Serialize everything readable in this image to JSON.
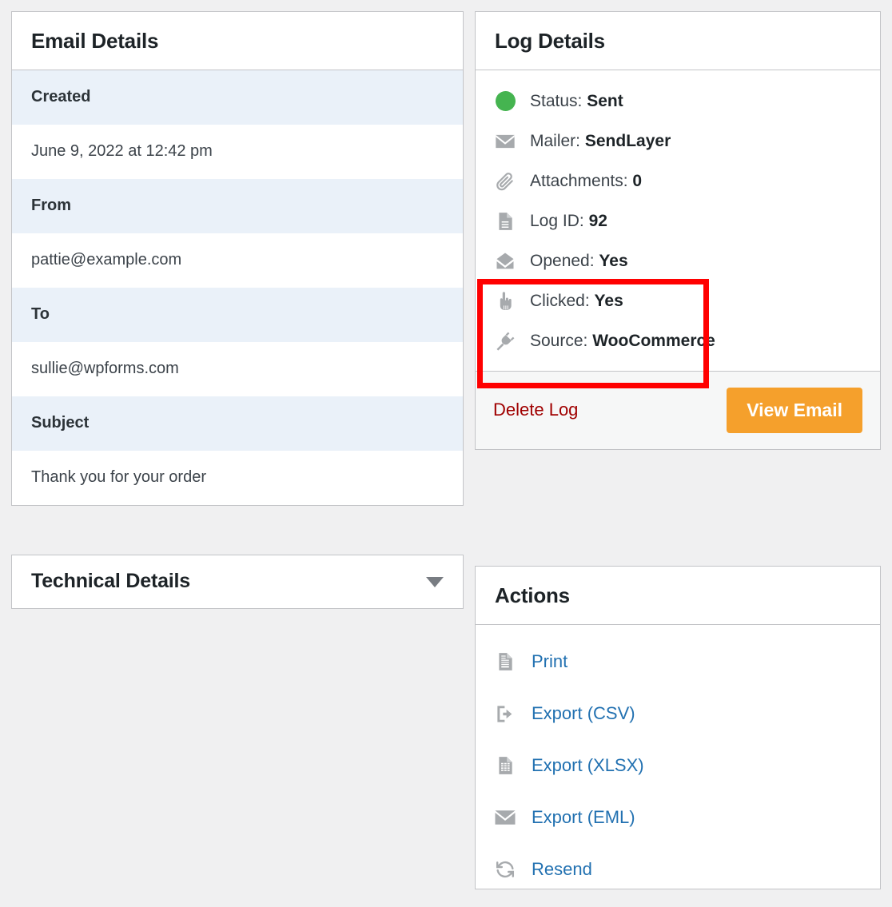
{
  "email_details": {
    "title": "Email Details",
    "fields": [
      {
        "label": "Created",
        "value": "June 9, 2022 at 12:42 pm"
      },
      {
        "label": "From",
        "value": "pattie@example.com"
      },
      {
        "label": "To",
        "value": "sullie@wpforms.com"
      },
      {
        "label": "Subject",
        "value": "Thank you for your order"
      }
    ]
  },
  "technical_details": {
    "title": "Technical Details",
    "toggle_icon": "chevron-down-icon",
    "expanded": false
  },
  "log_details": {
    "title": "Log Details",
    "rows": [
      {
        "icon": "status-dot-icon",
        "label": "Status:",
        "value": "Sent"
      },
      {
        "icon": "envelope-icon",
        "label": "Mailer:",
        "value": "SendLayer"
      },
      {
        "icon": "paperclip-icon",
        "label": "Attachments:",
        "value": "0"
      },
      {
        "icon": "document-icon",
        "label": "Log ID:",
        "value": "92"
      },
      {
        "icon": "envelope-open-icon",
        "label": "Opened:",
        "value": "Yes"
      },
      {
        "icon": "pointing-hand-icon",
        "label": "Clicked:",
        "value": "Yes"
      },
      {
        "icon": "plug-icon",
        "label": "Source:",
        "value": "WooCommerce"
      }
    ],
    "delete_label": "Delete Log",
    "view_email_label": "View Email",
    "status_color": "#45b450",
    "button_color": "#f5a02c",
    "delete_color": "#a00000",
    "highlight_color": "#ff0000"
  },
  "actions": {
    "title": "Actions",
    "items": [
      {
        "icon": "print-document-icon",
        "label": "Print"
      },
      {
        "icon": "export-arrow-icon",
        "label": "Export (CSV)"
      },
      {
        "icon": "spreadsheet-icon",
        "label": "Export (XLSX)"
      },
      {
        "icon": "envelope-icon",
        "label": "Export (EML)"
      },
      {
        "icon": "resend-sync-icon",
        "label": "Resend"
      }
    ],
    "link_color": "#2271b1"
  }
}
